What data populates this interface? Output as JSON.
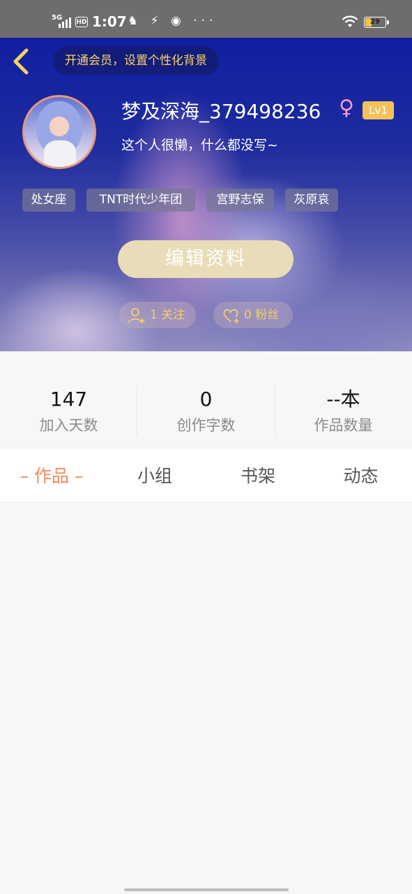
{
  "status_bar": {
    "network": "5G",
    "hd": "HD",
    "time": "1:07",
    "notification_icons": "♞ ⚡ ◉ ···",
    "battery": "29",
    "battery_level": 0.29
  },
  "header": {
    "vip_banner": "开通会员，设置个性化背景",
    "username": "梦及深海_379498236",
    "gender_symbol": "♀",
    "level": "Lv1",
    "bio": "这个人很懒，什么都没写~",
    "tags": [
      "处女座",
      "TNT时代少年团",
      "宫野志保",
      "灰原哀"
    ],
    "edit_button": "编辑资料",
    "following": "1 关注",
    "followers": "0 粉丝"
  },
  "stats": [
    {
      "value": "147",
      "label": "加入天数"
    },
    {
      "value": "0",
      "label": "创作字数"
    },
    {
      "value": "--本",
      "label": "作品数量"
    }
  ],
  "tabs": {
    "works": "– 作品 –",
    "groups": "小组",
    "bookshelf": "书架",
    "activity": "动态"
  },
  "colors": {
    "accent_orange": "#ee8a5b",
    "gold": "#f2d06b",
    "level_badge": "#f2c15a",
    "header_blue": "#1f2c9e"
  }
}
